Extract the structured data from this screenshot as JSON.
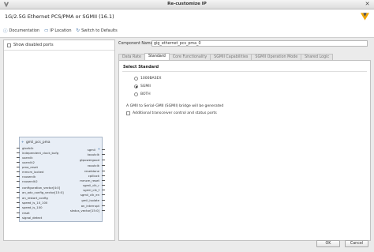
{
  "window": {
    "title": "Re-customize IP",
    "logo_icon": "vivado-logo-icon",
    "close_icon": "close-icon"
  },
  "header": {
    "ip_title": "1G/2.5G Ethernet PCS/PMA or SGMII (16.1)",
    "toolbar": [
      {
        "name": "documentation",
        "icon": "info-icon",
        "label": "Documentation"
      },
      {
        "name": "ip-location",
        "icon": "folder-icon",
        "label": "IP Location"
      },
      {
        "name": "switch-defaults",
        "icon": "refresh-icon",
        "label": "Switch to Defaults"
      }
    ]
  },
  "left_panel": {
    "show_disabled_label": "Show disabled ports",
    "block": {
      "name": "gmii_pcs_pma",
      "left_pins": [
        "gtrefclk",
        "independent_clock_bufg",
        "userclk",
        "userclk2",
        "pma_reset",
        "mmcm_locked",
        "rxuserclk",
        "rxuserclk2",
        "configuration_vector[4:0]",
        "an_adv_config_vector[15:0]",
        "an_restart_config",
        "speed_is_10_100",
        "speed_is_100",
        "reset",
        "signal_detect"
      ],
      "right_pins": [
        "sgmii",
        "txoutclk",
        "gtpowergood",
        "rxoutclk",
        "resetdone",
        "cplllock",
        "mmcm_reset",
        "sgmii_clk_r",
        "sgmii_clk_f",
        "sgmii_clk_en",
        "gmii_isolate",
        "an_interrupt",
        "status_vector[15:0]"
      ]
    }
  },
  "right_panel": {
    "component_name_label": "Component Name",
    "component_name_value": "gig_ethernet_pcs_pma_0",
    "tabs": [
      "Data Rate",
      "Standard",
      "Core Functionality",
      "SGMII Capabilities",
      "SGMII Operation Mode",
      "Shared Logic"
    ],
    "active_tab": "Standard",
    "standard": {
      "group_title": "Select Standard",
      "options": [
        "1000BASEX",
        "SGMII",
        "BOTH"
      ],
      "selected": "SGMII",
      "note": "A GMII to Serial-GMII (SGMII) bridge will be generated",
      "additional_label": "Additional transceiver control and status ports"
    }
  },
  "footer": {
    "ok_label": "OK",
    "cancel_label": "Cancel"
  },
  "colors": {
    "block_fill": "#e8eef6",
    "block_border": "#a8b6c8",
    "accent": "#3a6ea5"
  }
}
